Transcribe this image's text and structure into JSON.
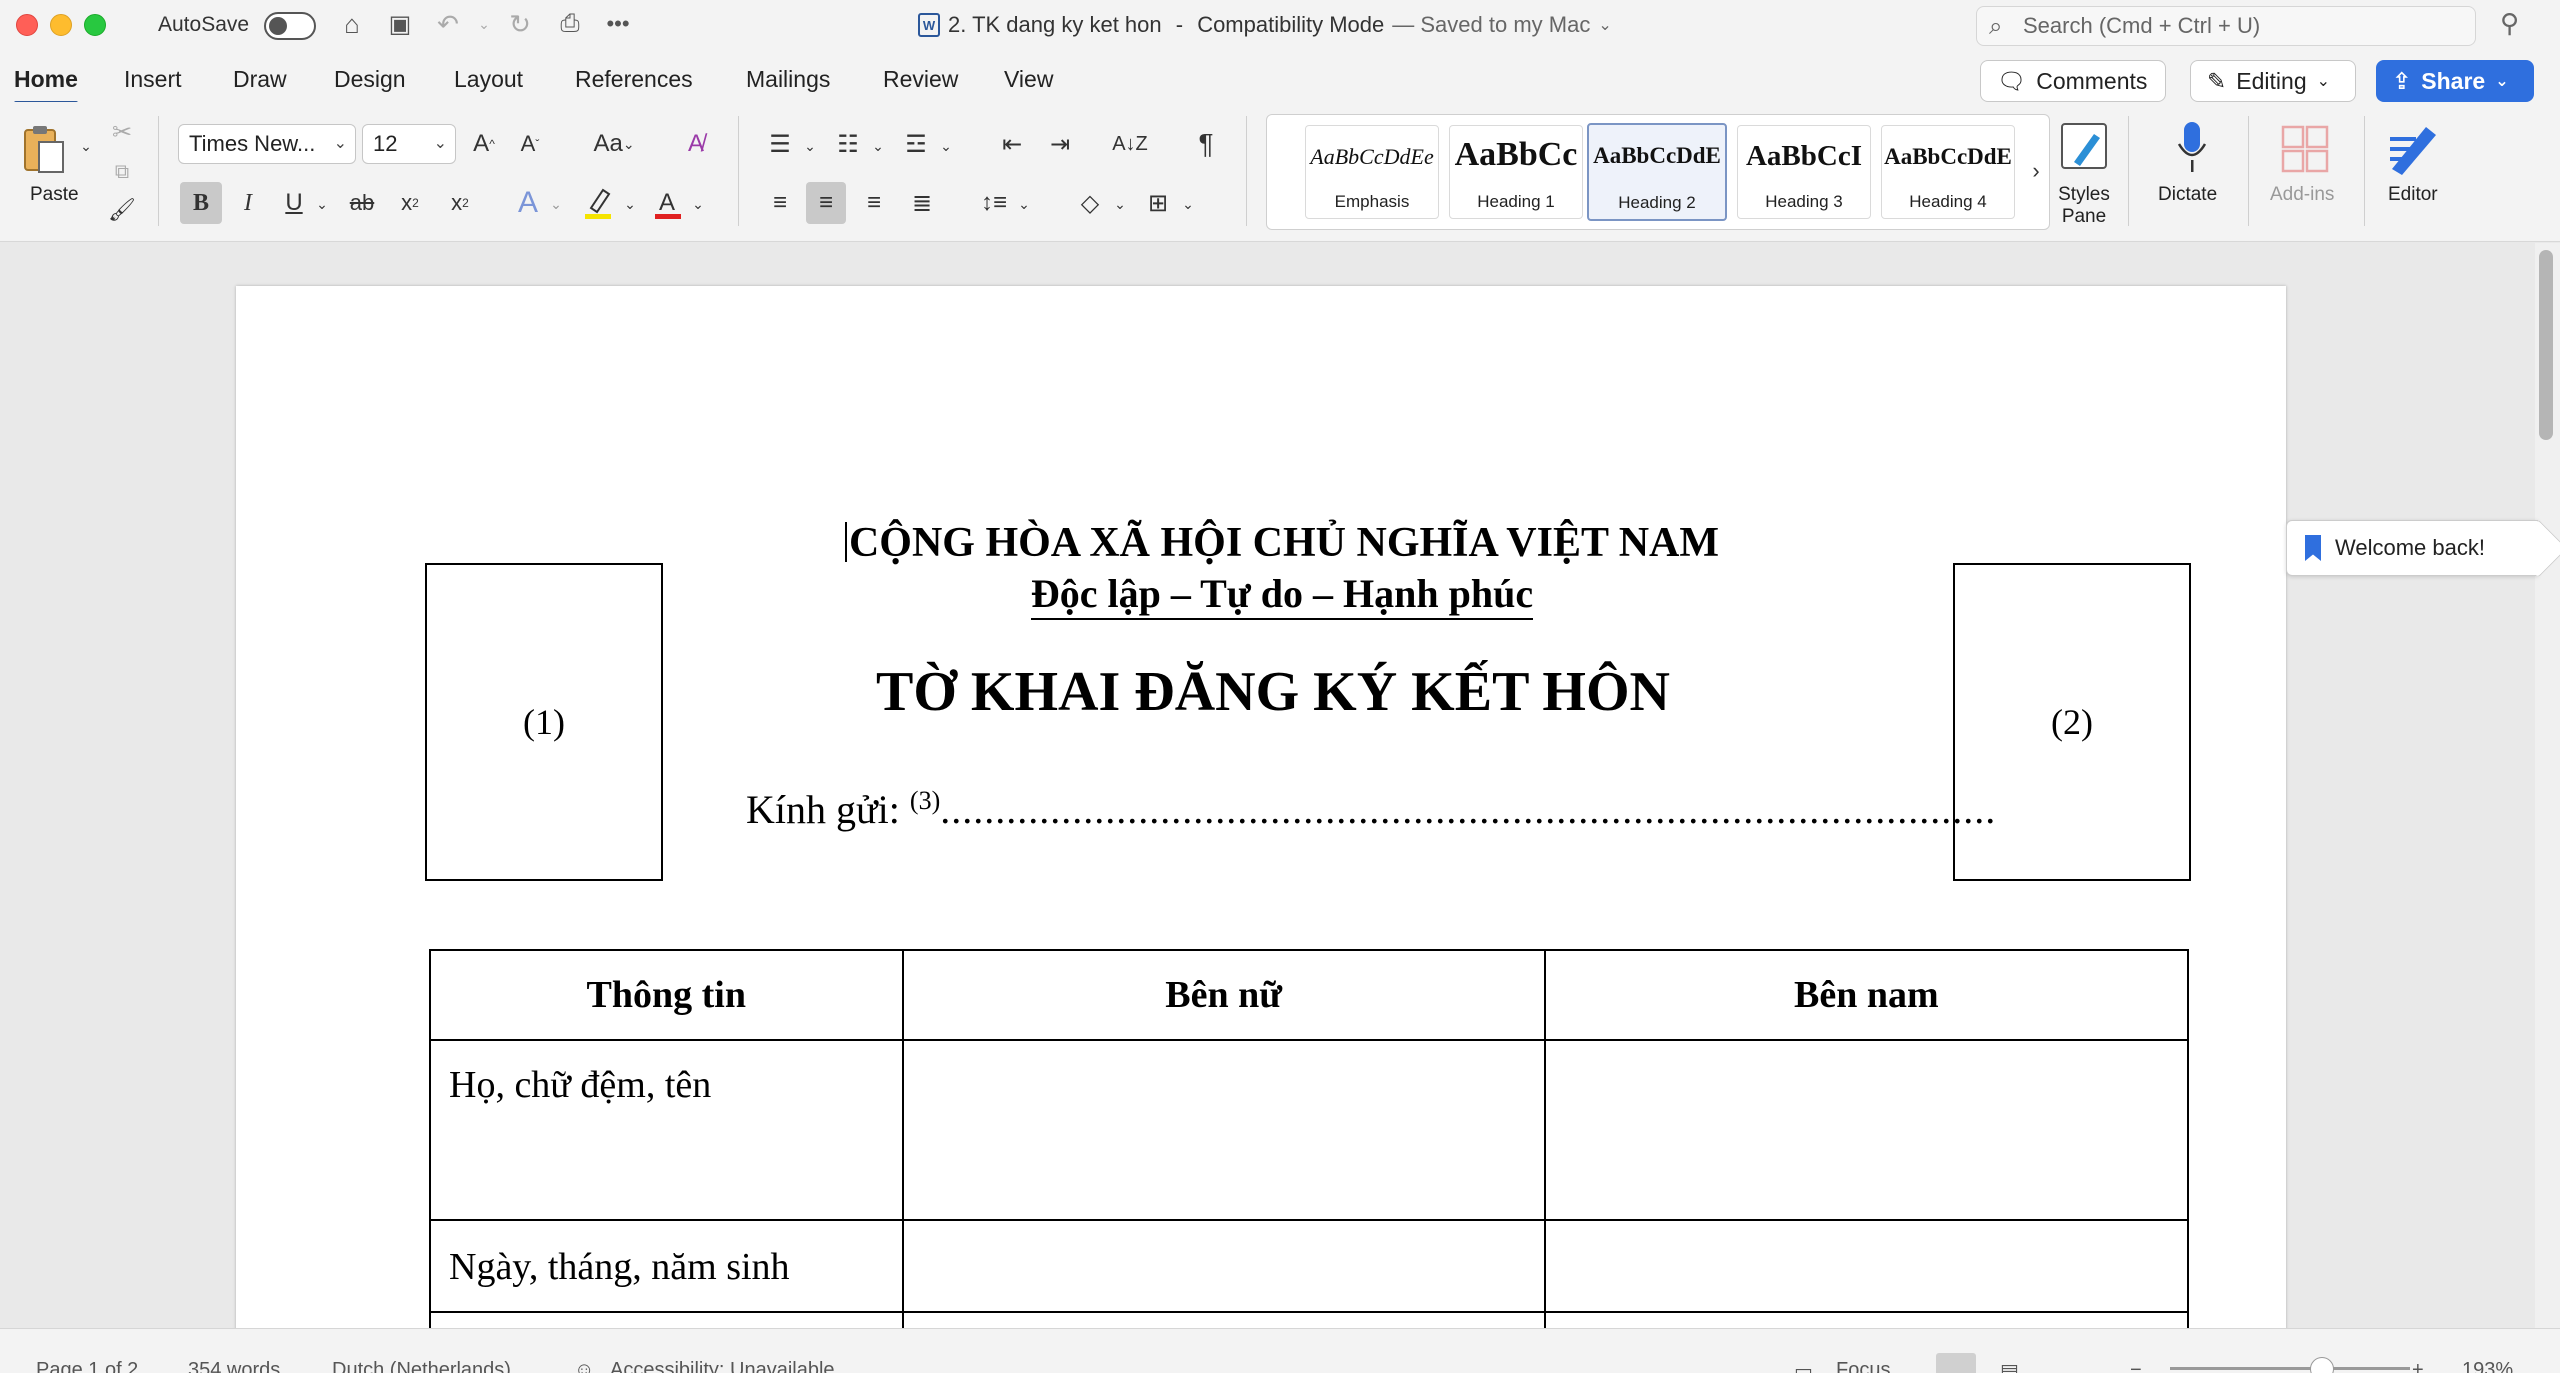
{
  "window": {
    "autosave_label": "AutoSave",
    "doc_name": "2. TK dang ky ket hon",
    "mode": "Compatibility Mode",
    "saved_status": "— Saved to my Mac",
    "search_placeholder": "Search (Cmd + Ctrl + U)"
  },
  "tabs": [
    "Home",
    "Insert",
    "Draw",
    "Design",
    "Layout",
    "References",
    "Mailings",
    "Review",
    "View"
  ],
  "right_buttons": {
    "comments": "Comments",
    "editing": "Editing",
    "share": "Share"
  },
  "ribbon": {
    "paste_label": "Paste",
    "font_name": "Times New...",
    "font_size": "12",
    "styles": [
      {
        "sample": "AaBbCcDdEe",
        "name": "Emphasis"
      },
      {
        "sample": "AaBbCc",
        "name": "Heading 1"
      },
      {
        "sample": "AaBbCcDdE",
        "name": "Heading 2"
      },
      {
        "sample": "AaBbCcI",
        "name": "Heading 3"
      },
      {
        "sample": "AaBbCcDdE",
        "name": "Heading 4"
      }
    ],
    "styles_pane": "Styles Pane",
    "dictate": "Dictate",
    "addins": "Add-ins",
    "editor": "Editor"
  },
  "document": {
    "header_line1": "CỘNG HÒA XÃ HỘI CHỦ NGHĨA VIỆT NAM",
    "header_line2": "Độc lập – Tự do – Hạnh phúc",
    "photo_left": "(1)",
    "photo_right": "(2)",
    "form_title": "TỜ KHAI ĐĂNG KÝ KẾT HÔN",
    "kinh_gui": "Kính gửi: ",
    "kinh_gui_sup": "(3)",
    "dots": "................................................................................................",
    "table_headers": [
      "Thông tin",
      "Bên nữ",
      "Bên nam"
    ],
    "rows": [
      "Họ, chữ đệm, tên",
      "Ngày, tháng, năm sinh"
    ]
  },
  "welcome": "Welcome back!",
  "status": {
    "page": "Page 1 of 2",
    "words": "354 words",
    "language": "Dutch (Netherlands)",
    "accessibility": "Accessibility: Unavailable",
    "focus": "Focus",
    "zoom": "193%"
  }
}
